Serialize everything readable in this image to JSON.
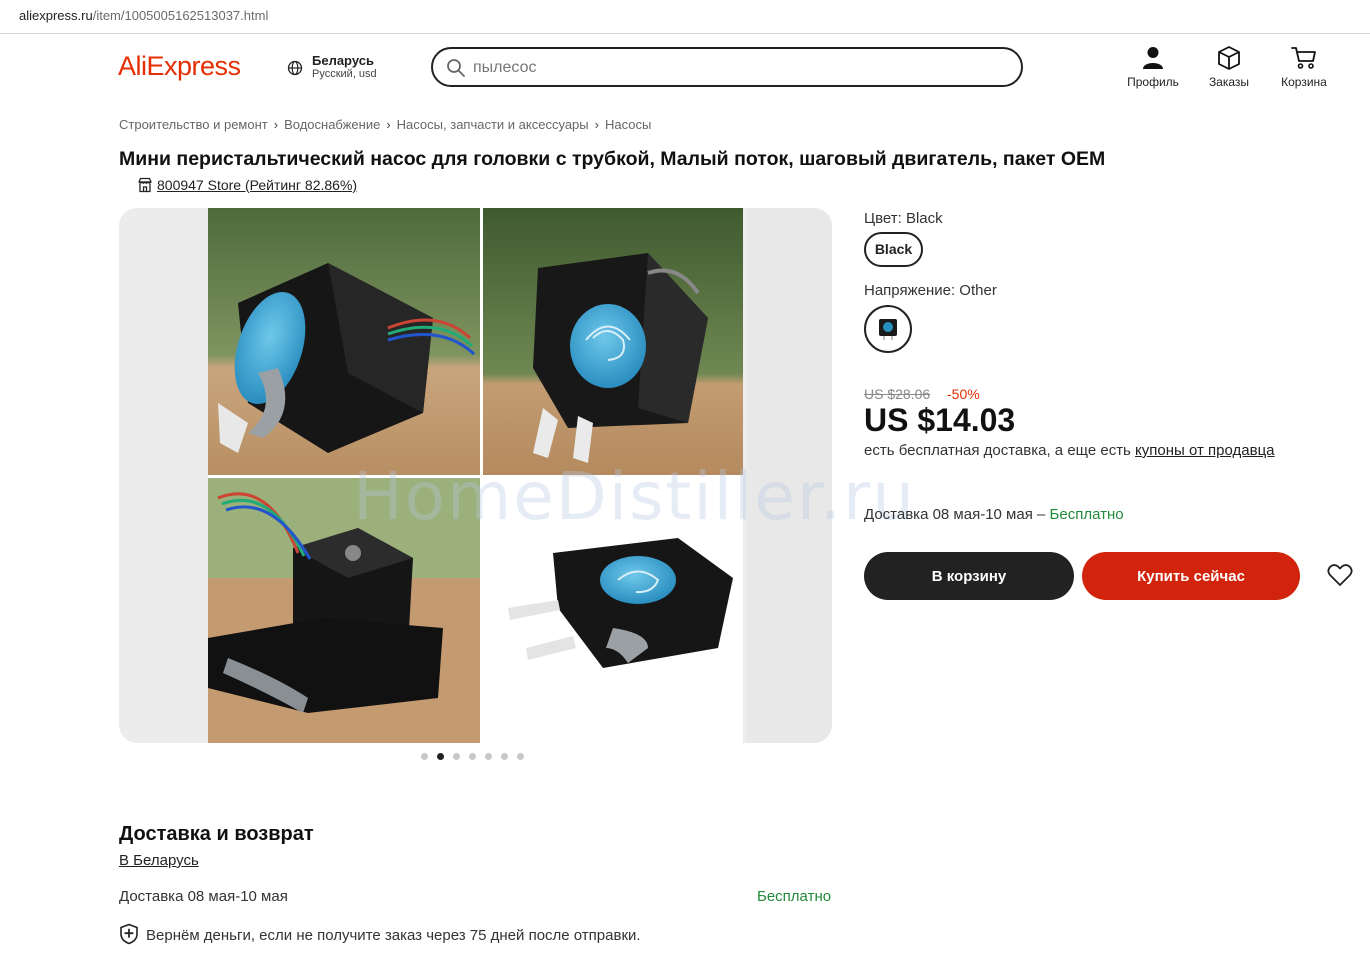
{
  "browser": {
    "url_domain": "aliexpress.ru",
    "url_path": "/item/1005005162513037.html"
  },
  "header": {
    "logo": "AliExpress",
    "region_country": "Беларусь",
    "region_lang": "Русский, usd",
    "search_value": "пылесос",
    "nav": [
      {
        "label": "Профиль",
        "icon": "user-icon"
      },
      {
        "label": "Заказы",
        "icon": "box-icon"
      },
      {
        "label": "Корзина",
        "icon": "cart-icon"
      }
    ]
  },
  "breadcrumbs": [
    "Строительство и ремонт",
    "Водоснабжение",
    "Насосы, запчасти и аксессуары",
    "Насосы"
  ],
  "product": {
    "title": "Мини перистальтический насос для головки с трубкой, Малый поток, шаговый двигатель, пакет OEM",
    "store": "800947 Store (Рейтинг 82.86%)",
    "gallery": {
      "dots": 7,
      "active_dot": 2
    },
    "watermark": "HomeDistiller.ru",
    "color_label": "Цвет: Black",
    "color_option": "Black",
    "voltage_label": "Напряжение: Other",
    "old_price": "US $28.06",
    "discount": "-50%",
    "price": "US $14.03",
    "shipping_note_prefix": "есть бесплатная доставка, а еще есть ",
    "shipping_note_link": "купоны от продавца",
    "delivery_dates": "Доставка 08 мая-10 мая – ",
    "delivery_cost": "Бесплатно",
    "add_to_cart": "В корзину",
    "buy_now": "Купить сейчас"
  },
  "delivery_section": {
    "heading": "Доставка и возврат",
    "destination": "В Беларусь",
    "delivery_dates": "Доставка 08 мая-10 мая",
    "delivery_cost": "Бесплатно",
    "guarantee": "Вернём деньги, если не получите заказ через 75 дней после отправки."
  },
  "colors": {
    "brand": "#e62e04",
    "buy_button": "#d2240d",
    "cart_button": "#222222",
    "free_text": "#218a3b"
  }
}
